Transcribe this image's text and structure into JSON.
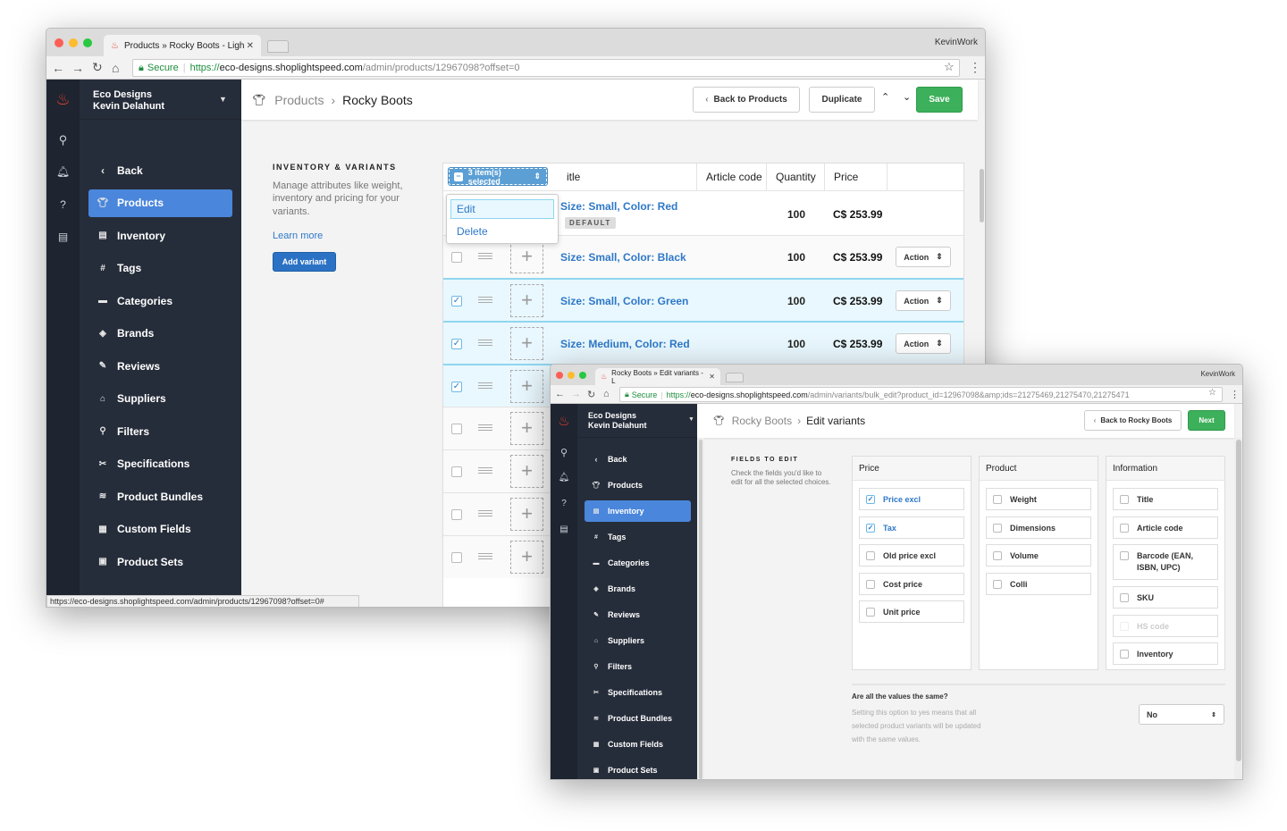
{
  "window1": {
    "tab_title": "Products » Rocky Boots - Ligh",
    "profile": "KevinWork",
    "url": {
      "secure": "Secure",
      "scheme": "https://",
      "host": "eco-designs.shoplightspeed.com",
      "path": "/admin/products/12967098?offset=0"
    },
    "store": "Eco Designs",
    "user": "Kevin Delahunt",
    "sidebar": {
      "back": "Back",
      "items": [
        {
          "label": "Products",
          "icon": "shirt",
          "active": true
        },
        {
          "label": "Inventory",
          "icon": "archive"
        },
        {
          "label": "Tags",
          "icon": "hash"
        },
        {
          "label": "Categories",
          "icon": "folder"
        },
        {
          "label": "Brands",
          "icon": "tag"
        },
        {
          "label": "Reviews",
          "icon": "review"
        },
        {
          "label": "Suppliers",
          "icon": "factory"
        },
        {
          "label": "Filters",
          "icon": "filter"
        },
        {
          "label": "Specifications",
          "icon": "tools"
        },
        {
          "label": "Product Bundles",
          "icon": "layers"
        },
        {
          "label": "Custom Fields",
          "icon": "grid"
        },
        {
          "label": "Product Sets",
          "icon": "box"
        }
      ]
    },
    "breadcrumb": {
      "parent": "Products",
      "current": "Rocky Boots"
    },
    "buttons": {
      "back": "Back to Products",
      "duplicate": "Duplicate",
      "save": "Save"
    },
    "section": {
      "title": "INVENTORY & VARIANTS",
      "description": "Manage attributes like weight, inventory and pricing for your variants.",
      "learn_more": "Learn more",
      "add_variant": "Add variant"
    },
    "table": {
      "bulk_label": "3 item(s) selected",
      "bulk_menu": [
        "Edit",
        "Delete"
      ],
      "columns": [
        "Title",
        "Article code",
        "Quantity",
        "Price"
      ],
      "title_visible": "itle",
      "default_badge": "DEFAULT",
      "action_label": "Action",
      "rows": [
        {
          "title": "Size: Small, Color: Red",
          "quantity": "100",
          "price": "C$ 253.99",
          "checked": false,
          "default": true
        },
        {
          "title": "Size: Small, Color: Black",
          "quantity": "100",
          "price": "C$ 253.99",
          "checked": false
        },
        {
          "title": "Size: Small, Color: Green",
          "quantity": "100",
          "price": "C$ 253.99",
          "checked": true
        },
        {
          "title": "Size: Medium, Color: Red",
          "quantity": "100",
          "price": "C$ 253.99",
          "checked": true
        },
        {
          "checked": true
        },
        {
          "checked": false
        },
        {
          "checked": false
        },
        {
          "checked": false
        },
        {
          "checked": false
        }
      ]
    },
    "status_url": "https://eco-designs.shoplightspeed.com/admin/products/12967098?offset=0#"
  },
  "window2": {
    "tab_title": "Rocky Boots » Edit variants - L",
    "profile": "KevinWork",
    "url": {
      "secure": "Secure",
      "scheme": "https://",
      "host": "eco-designs.shoplightspeed.com",
      "path": "/admin/variants/bulk_edit?product_id=12967098&amp;ids=21275469,21275470,21275471"
    },
    "store": "Eco Designs",
    "user": "Kevin Delahunt",
    "sidebar": {
      "back": "Back",
      "items": [
        {
          "label": "Products",
          "icon": "shirt"
        },
        {
          "label": "Inventory",
          "icon": "archive",
          "active": true
        },
        {
          "label": "Tags",
          "icon": "hash"
        },
        {
          "label": "Categories",
          "icon": "folder"
        },
        {
          "label": "Brands",
          "icon": "tag"
        },
        {
          "label": "Reviews",
          "icon": "review"
        },
        {
          "label": "Suppliers",
          "icon": "factory"
        },
        {
          "label": "Filters",
          "icon": "filter"
        },
        {
          "label": "Specifications",
          "icon": "tools"
        },
        {
          "label": "Product Bundles",
          "icon": "layers"
        },
        {
          "label": "Custom Fields",
          "icon": "grid"
        },
        {
          "label": "Product Sets",
          "icon": "box"
        }
      ]
    },
    "breadcrumb": {
      "parent": "Rocky Boots",
      "current": "Edit variants"
    },
    "buttons": {
      "back": "Back to Rocky Boots",
      "next": "Next"
    },
    "section": {
      "title": "FIELDS TO EDIT",
      "description": "Check the fields you'd like to edit for all the selected choices."
    },
    "groups": [
      {
        "title": "Price",
        "fields": [
          {
            "label": "Price excl",
            "checked": true
          },
          {
            "label": "Tax",
            "checked": true
          },
          {
            "label": "Old price excl"
          },
          {
            "label": "Cost price"
          },
          {
            "label": "Unit price"
          }
        ]
      },
      {
        "title": "Product",
        "fields": [
          {
            "label": "Weight"
          },
          {
            "label": "Dimensions"
          },
          {
            "label": "Volume"
          },
          {
            "label": "Colli"
          }
        ]
      },
      {
        "title": "Information",
        "fields": [
          {
            "label": "Title"
          },
          {
            "label": "Article code"
          },
          {
            "label": "Barcode (EAN, ISBN, UPC)"
          },
          {
            "label": "SKU"
          },
          {
            "label": "HS code",
            "disabled": true
          },
          {
            "label": "Inventory"
          }
        ]
      }
    ],
    "same_values": {
      "question": "Are all the values the same?",
      "help": "Setting this option to yes means that all selected product variants will be updated with the same values.",
      "value": "No"
    }
  },
  "colors": {
    "accent": "#4a86db",
    "save": "#3cb05a",
    "link": "#2e78c8",
    "sidebar": "#262d3a",
    "logo": "#e1402f"
  }
}
